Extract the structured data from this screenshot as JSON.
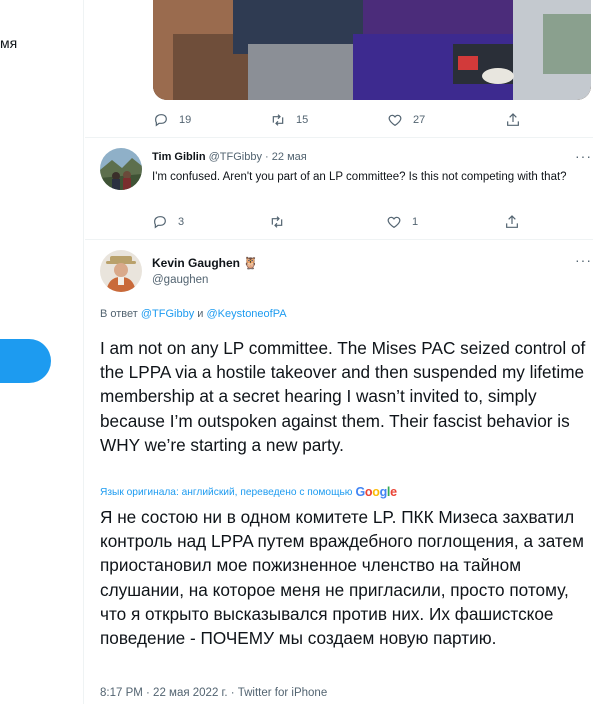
{
  "sidebar": {
    "partial_text": "мя"
  },
  "top_tweet": {
    "replies": "19",
    "retweets": "15",
    "likes": "27"
  },
  "reply_tweet": {
    "display_name": "Tim Giblin",
    "handle": "@TFGibby",
    "separator": "·",
    "date": "22 мая",
    "text": "I'm confused. Aren't you part of an LP committee? Is this not competing with that?",
    "replies": "3",
    "retweets": "",
    "likes": "1"
  },
  "main_tweet": {
    "display_name": "Kevin Gaughen",
    "emoji": "🦉",
    "handle": "@gaughen",
    "reply_prefix": "В ответ",
    "reply_user1": "@TFGibby",
    "reply_and": "и",
    "reply_user2": "@KeystoneofPA",
    "text": "I am not on any LP committee. The Mises PAC seized control of the LPPA via a hostile takeover and then suspended my lifetime membership at a secret hearing I wasn’t invited to, simply because I’m outspoken against them. Their fascist behavior is WHY we’re starting a new party.",
    "translated_by": "Язык оригинала: английский, переведено с помощью",
    "google": "Google",
    "translated_text": "Я не состою ни в одном комитете LP. ПКК Мизеса захватил контроль над LPPA путем враждебного поглощения, а затем приостановил мое пожизненное членство на тайном слушании, на которое меня не пригласили, просто потому, что я открыто высказывался против них. Их фашистское поведение - ПОЧЕМУ мы создаем новую партию.",
    "meta": "8:17 PM · 22 мая 2022 г. · Twitter for iPhone"
  },
  "colors": {
    "accent": "#1d9bf0",
    "secondary_text": "#536471",
    "divider": "#eff3f4"
  }
}
